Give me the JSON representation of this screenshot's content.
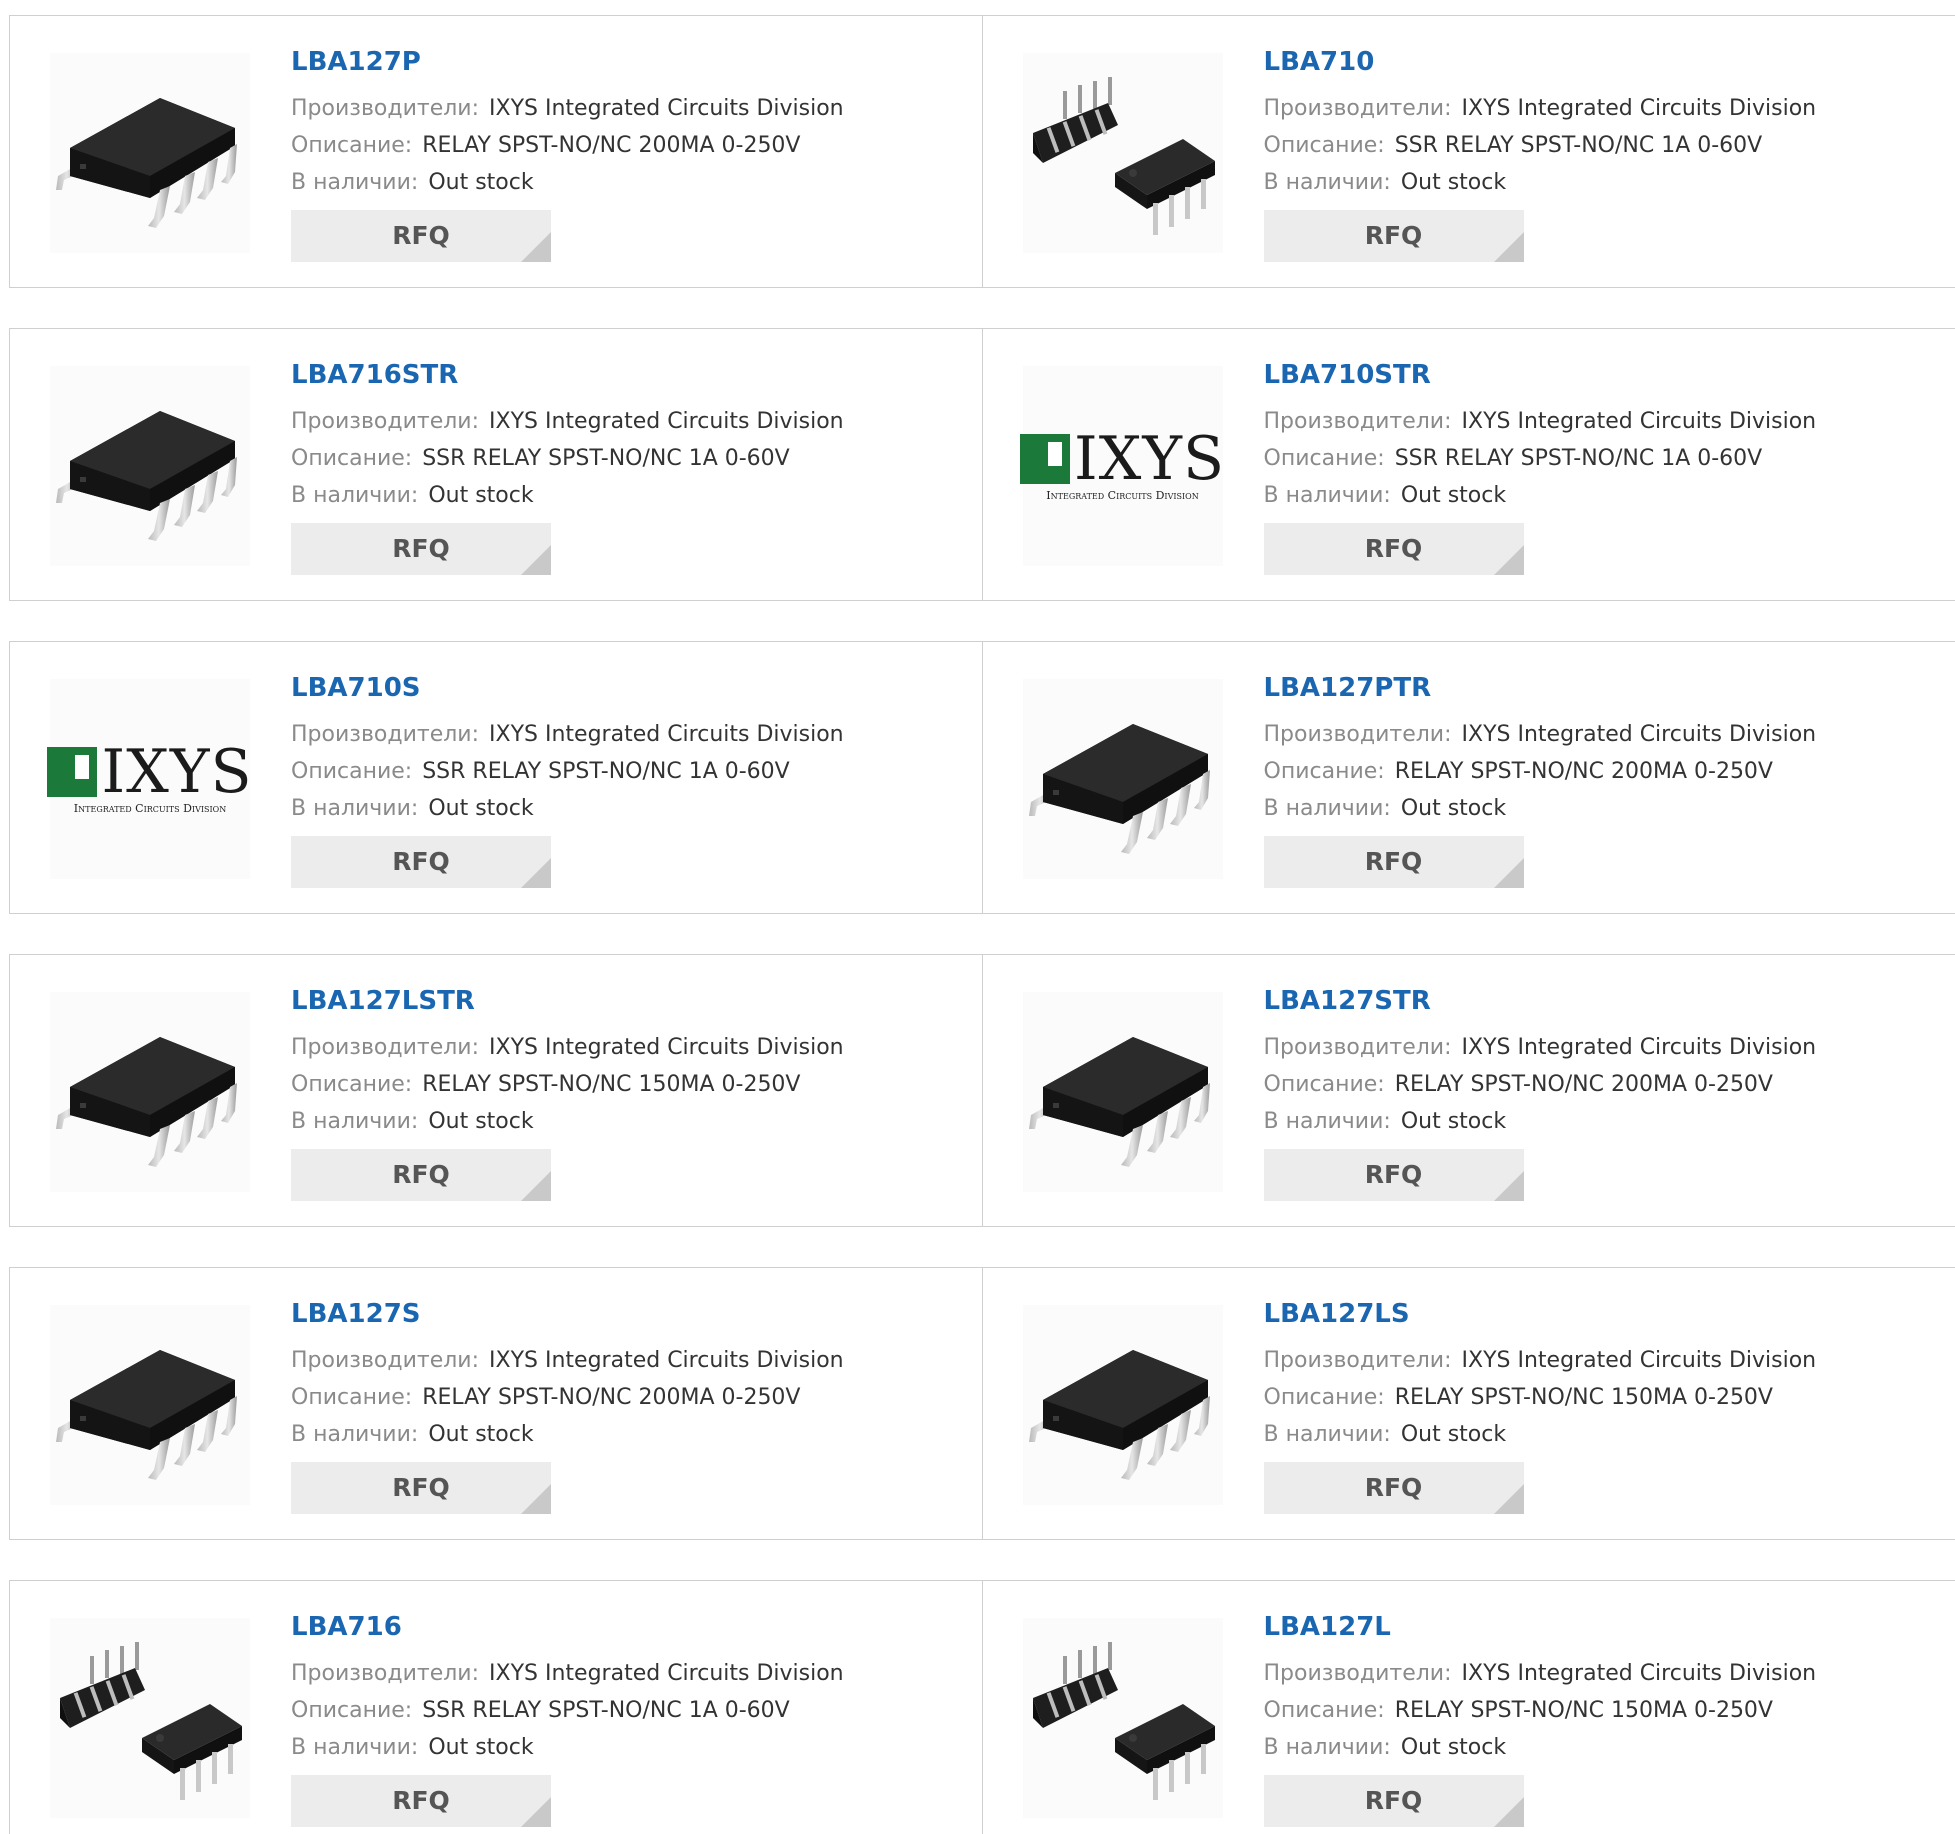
{
  "labels": {
    "manufacturer": "Производители:",
    "description": "Описание:",
    "stock": "В наличии:",
    "rfq": "RFQ"
  },
  "products": [
    {
      "pn": "LBA127P",
      "manufacturer": "IXYS Integrated Circuits Division",
      "description": "RELAY SPST-NO/NC 200MA 0-250V",
      "stock": "Out stock",
      "image": "smd-chip"
    },
    {
      "pn": "LBA710",
      "manufacturer": "IXYS Integrated Circuits Division",
      "description": "SSR RELAY SPST-NO/NC 1A 0-60V",
      "stock": "Out stock",
      "image": "dip-chips"
    },
    {
      "pn": "LBA716STR",
      "manufacturer": "IXYS Integrated Circuits Division",
      "description": "SSR RELAY SPST-NO/NC 1A 0-60V",
      "stock": "Out stock",
      "image": "smd-chip"
    },
    {
      "pn": "LBA710STR",
      "manufacturer": "IXYS Integrated Circuits Division",
      "description": "SSR RELAY SPST-NO/NC 1A 0-60V",
      "stock": "Out stock",
      "image": "ixys-logo"
    },
    {
      "pn": "LBA710S",
      "manufacturer": "IXYS Integrated Circuits Division",
      "description": "SSR RELAY SPST-NO/NC 1A 0-60V",
      "stock": "Out stock",
      "image": "ixys-logo"
    },
    {
      "pn": "LBA127PTR",
      "manufacturer": "IXYS Integrated Circuits Division",
      "description": "RELAY SPST-NO/NC 200MA 0-250V",
      "stock": "Out stock",
      "image": "smd-chip"
    },
    {
      "pn": "LBA127LSTR",
      "manufacturer": "IXYS Integrated Circuits Division",
      "description": "RELAY SPST-NO/NC 150MA 0-250V",
      "stock": "Out stock",
      "image": "smd-chip"
    },
    {
      "pn": "LBA127STR",
      "manufacturer": "IXYS Integrated Circuits Division",
      "description": "RELAY SPST-NO/NC 200MA 0-250V",
      "stock": "Out stock",
      "image": "smd-chip"
    },
    {
      "pn": "LBA127S",
      "manufacturer": "IXYS Integrated Circuits Division",
      "description": "RELAY SPST-NO/NC 200MA 0-250V",
      "stock": "Out stock",
      "image": "smd-chip"
    },
    {
      "pn": "LBA127LS",
      "manufacturer": "IXYS Integrated Circuits Division",
      "description": "RELAY SPST-NO/NC 150MA 0-250V",
      "stock": "Out stock",
      "image": "smd-chip"
    },
    {
      "pn": "LBA716",
      "manufacturer": "IXYS Integrated Circuits Division",
      "description": "SSR RELAY SPST-NO/NC 1A 0-60V",
      "stock": "Out stock",
      "image": "dip-chips"
    },
    {
      "pn": "LBA127L",
      "manufacturer": "IXYS Integrated Circuits Division",
      "description": "RELAY SPST-NO/NC 150MA 0-250V",
      "stock": "Out stock",
      "image": "dip-chips"
    }
  ],
  "logo": {
    "brand": "IXYS",
    "subtitle": "Integrated Circuits Division",
    "color": "#1b7a3a"
  },
  "colors": {
    "link": "#1a66b0",
    "label": "#8a8a8a",
    "value": "#333333",
    "button_bg": "#ececec"
  }
}
